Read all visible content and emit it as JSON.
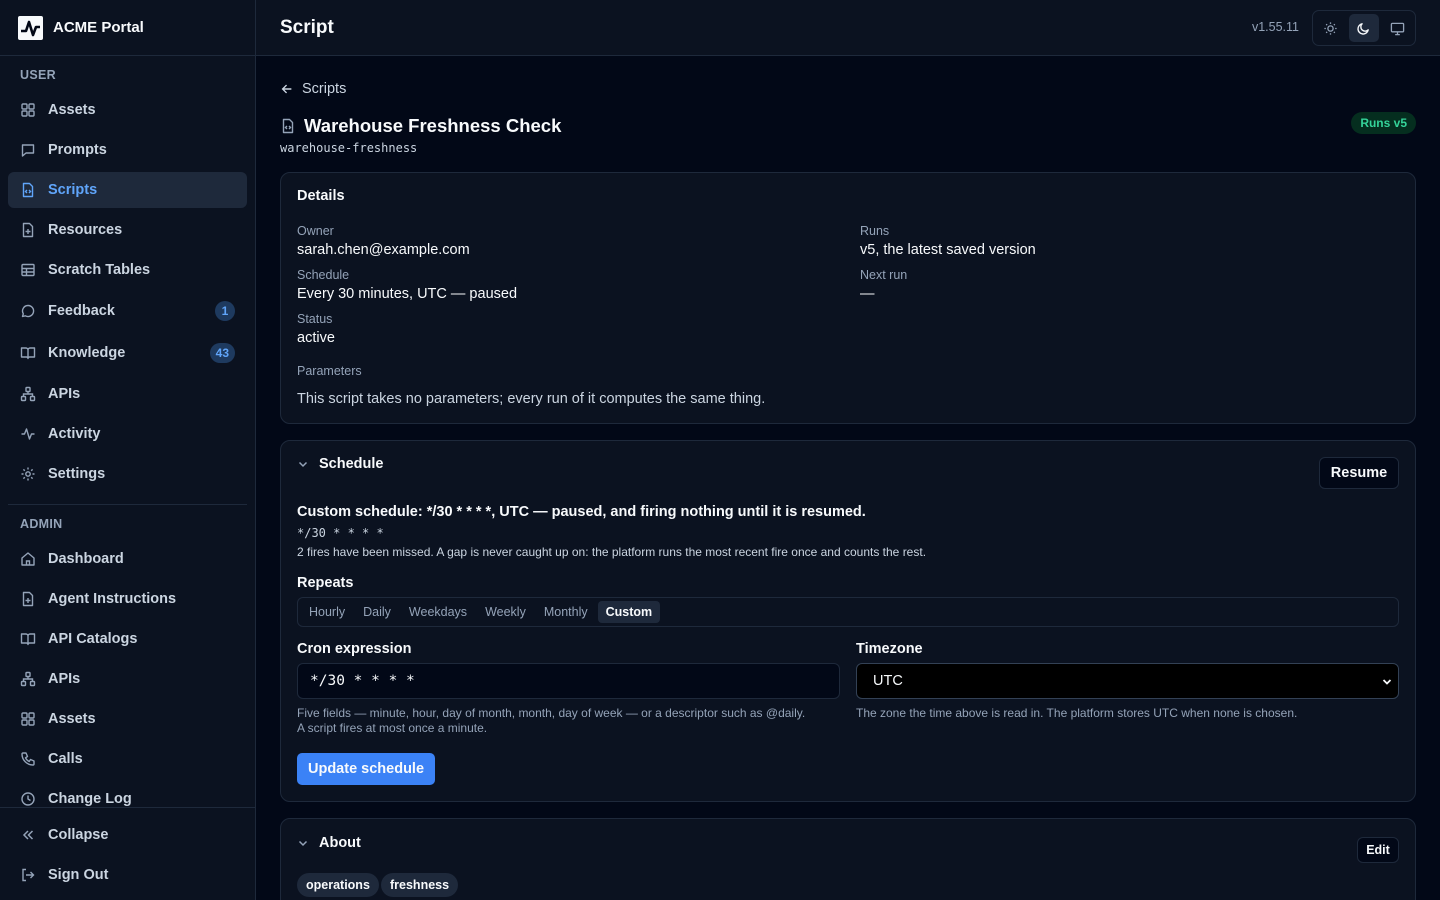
{
  "app": {
    "name": "ACME Portal",
    "version": "v1.55.11"
  },
  "topbar": {
    "title": "Script"
  },
  "theme": {
    "options": [
      "light-icon",
      "dark-icon",
      "system-icon"
    ],
    "selected": "dark"
  },
  "sidebar": {
    "user_title": "USER",
    "user_items": [
      {
        "label": "Assets",
        "icon": "grid-icon"
      },
      {
        "label": "Prompts",
        "icon": "message-square-icon"
      },
      {
        "label": "Scripts",
        "icon": "file-code-icon",
        "active": true
      },
      {
        "label": "Resources",
        "icon": "file-plus-icon"
      },
      {
        "label": "Scratch Tables",
        "icon": "table-icon"
      },
      {
        "label": "Feedback",
        "icon": "message-circle-icon",
        "badge": "1"
      },
      {
        "label": "Knowledge",
        "icon": "book-open-icon",
        "badge": "43"
      },
      {
        "label": "APIs",
        "icon": "network-icon"
      },
      {
        "label": "Activity",
        "icon": "activity-icon"
      },
      {
        "label": "Settings",
        "icon": "gear-icon"
      }
    ],
    "admin_title": "ADMIN",
    "admin_items": [
      {
        "label": "Dashboard",
        "icon": "home-icon"
      },
      {
        "label": "Agent Instructions",
        "icon": "file-plus-icon"
      },
      {
        "label": "API Catalogs",
        "icon": "book-open-icon"
      },
      {
        "label": "APIs",
        "icon": "network-icon"
      },
      {
        "label": "Assets",
        "icon": "grid-icon"
      },
      {
        "label": "Calls",
        "icon": "phone-icon"
      },
      {
        "label": "Change Log",
        "icon": "clock-icon"
      }
    ],
    "footer": {
      "collapse": "Collapse",
      "sign_out": "Sign Out"
    }
  },
  "script": {
    "back_label": "Scripts",
    "title": "Warehouse Freshness Check",
    "slug": "warehouse-freshness",
    "runs_badge": "Runs v5"
  },
  "details": {
    "title": "Details",
    "owner_label": "Owner",
    "owner": "sarah.chen@example.com",
    "runs_label": "Runs",
    "runs": "v5, the latest saved version",
    "schedule_label": "Schedule",
    "schedule": "Every 30 minutes, UTC — paused",
    "next_run_label": "Next run",
    "next_run": "—",
    "status_label": "Status",
    "status": "active",
    "parameters_label": "Parameters",
    "parameters": "This script takes no parameters; every run of it computes the same thing."
  },
  "schedule": {
    "title": "Schedule",
    "resume_label": "Resume",
    "summary": "Custom schedule: */30 * * * *, UTC — paused, and firing nothing until it is resumed.",
    "cron_display": "*/30 * * * *",
    "missed_note": "2 fires have been missed. A gap is never caught up on: the platform runs the most recent fire once and counts the rest.",
    "repeats_label": "Repeats",
    "repeat_options": [
      "Hourly",
      "Daily",
      "Weekdays",
      "Weekly",
      "Monthly",
      "Custom"
    ],
    "repeat_selected": "Custom",
    "cron_label": "Cron expression",
    "cron_value": "*/30 * * * *",
    "cron_help_1": "Five fields — minute, hour, day of month, month, day of week — or a descriptor such as @daily.",
    "cron_help_2": "A script fires at most once a minute.",
    "timezone_label": "Timezone",
    "timezone_value": "UTC",
    "timezone_help": "The zone the time above is read in. The platform stores UTC when none is chosen.",
    "update_label": "Update schedule"
  },
  "about": {
    "title": "About",
    "edit_label": "Edit",
    "tags": [
      "operations",
      "freshness"
    ]
  },
  "colors": {
    "accent": "#3b82f6",
    "success": "#34d399",
    "background": "#020817",
    "panel": "#0b1220",
    "border": "#1e293b"
  }
}
